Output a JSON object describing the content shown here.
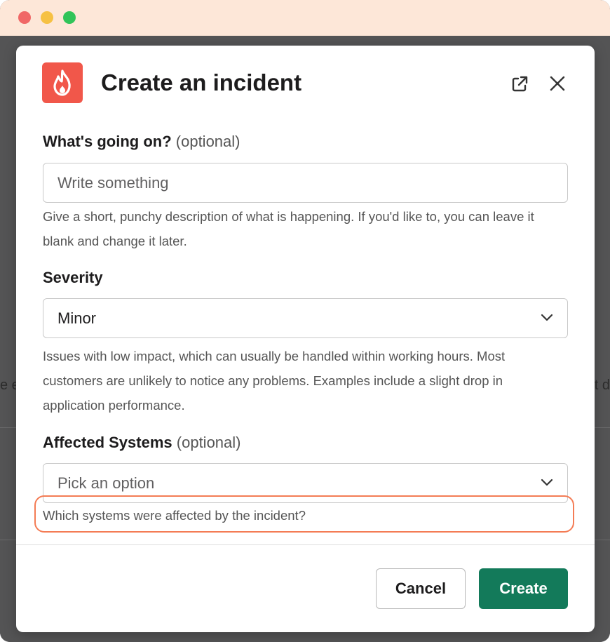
{
  "window": {
    "traffic_lights": [
      "close",
      "minimize",
      "maximize"
    ]
  },
  "background": {
    "left_fragment": "e e",
    "right_fragment": "t d"
  },
  "modal": {
    "title": "Create an incident",
    "app_icon": "flame-icon",
    "header_buttons": [
      "external-link-icon",
      "close-icon"
    ],
    "fields": {
      "description": {
        "label": "What's going on?",
        "optional": "(optional)",
        "placeholder": "Write something",
        "hint": "Give a short, punchy description of what is happening. If you'd like to, you can leave it blank and change it later."
      },
      "severity": {
        "label": "Severity",
        "value": "Minor",
        "hint": "Issues with low impact, which can usually be handled within working hours. Most customers are unlikely to notice any problems. Examples include a slight drop in application performance."
      },
      "affected_systems": {
        "label": "Affected Systems",
        "optional": "(optional)",
        "placeholder": "Pick an option",
        "hint": "Which systems were affected by the incident?"
      }
    },
    "buttons": {
      "cancel": "Cancel",
      "create": "Create"
    }
  },
  "colors": {
    "titlebar": "#fde7d8",
    "app_icon": "#f1574a",
    "primary": "#137a5a",
    "highlight": "#f47c55"
  }
}
